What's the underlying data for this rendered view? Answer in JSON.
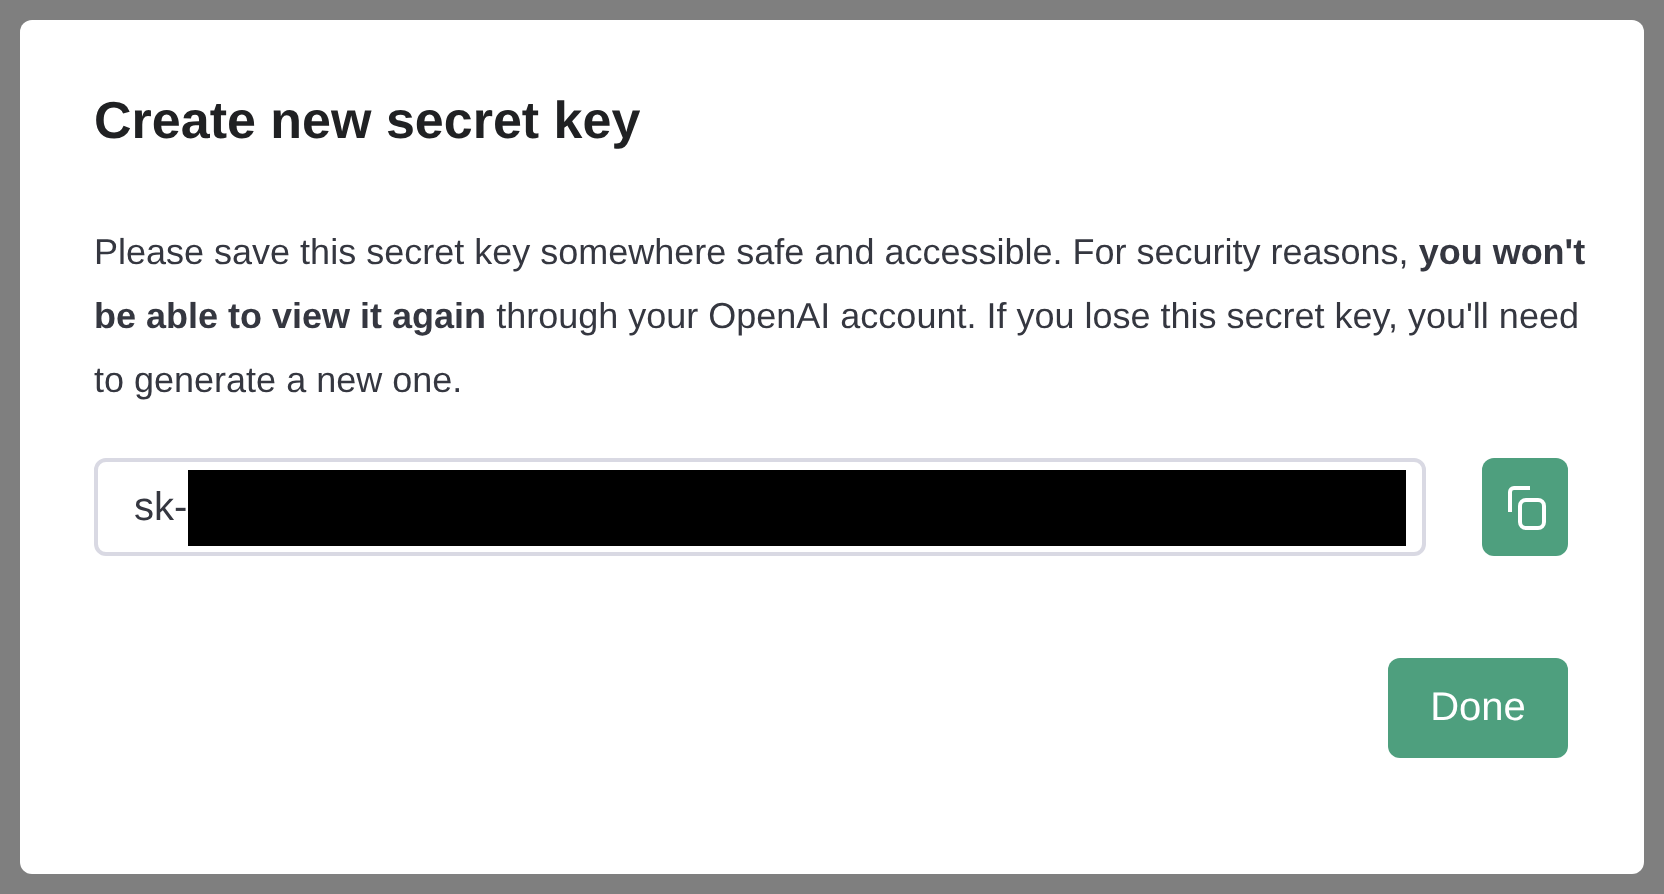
{
  "dialog": {
    "title": "Create new secret key",
    "message": "Please save this secret key somewhere safe and accessible. For security reasons, **you won't be able to view it again** through your OpenAI account. If you lose this secret key, you'll need to generate a new one.",
    "key_field": {
      "value": "sk-",
      "redacted": true
    },
    "buttons": [
      "Done"
    ]
  }
}
